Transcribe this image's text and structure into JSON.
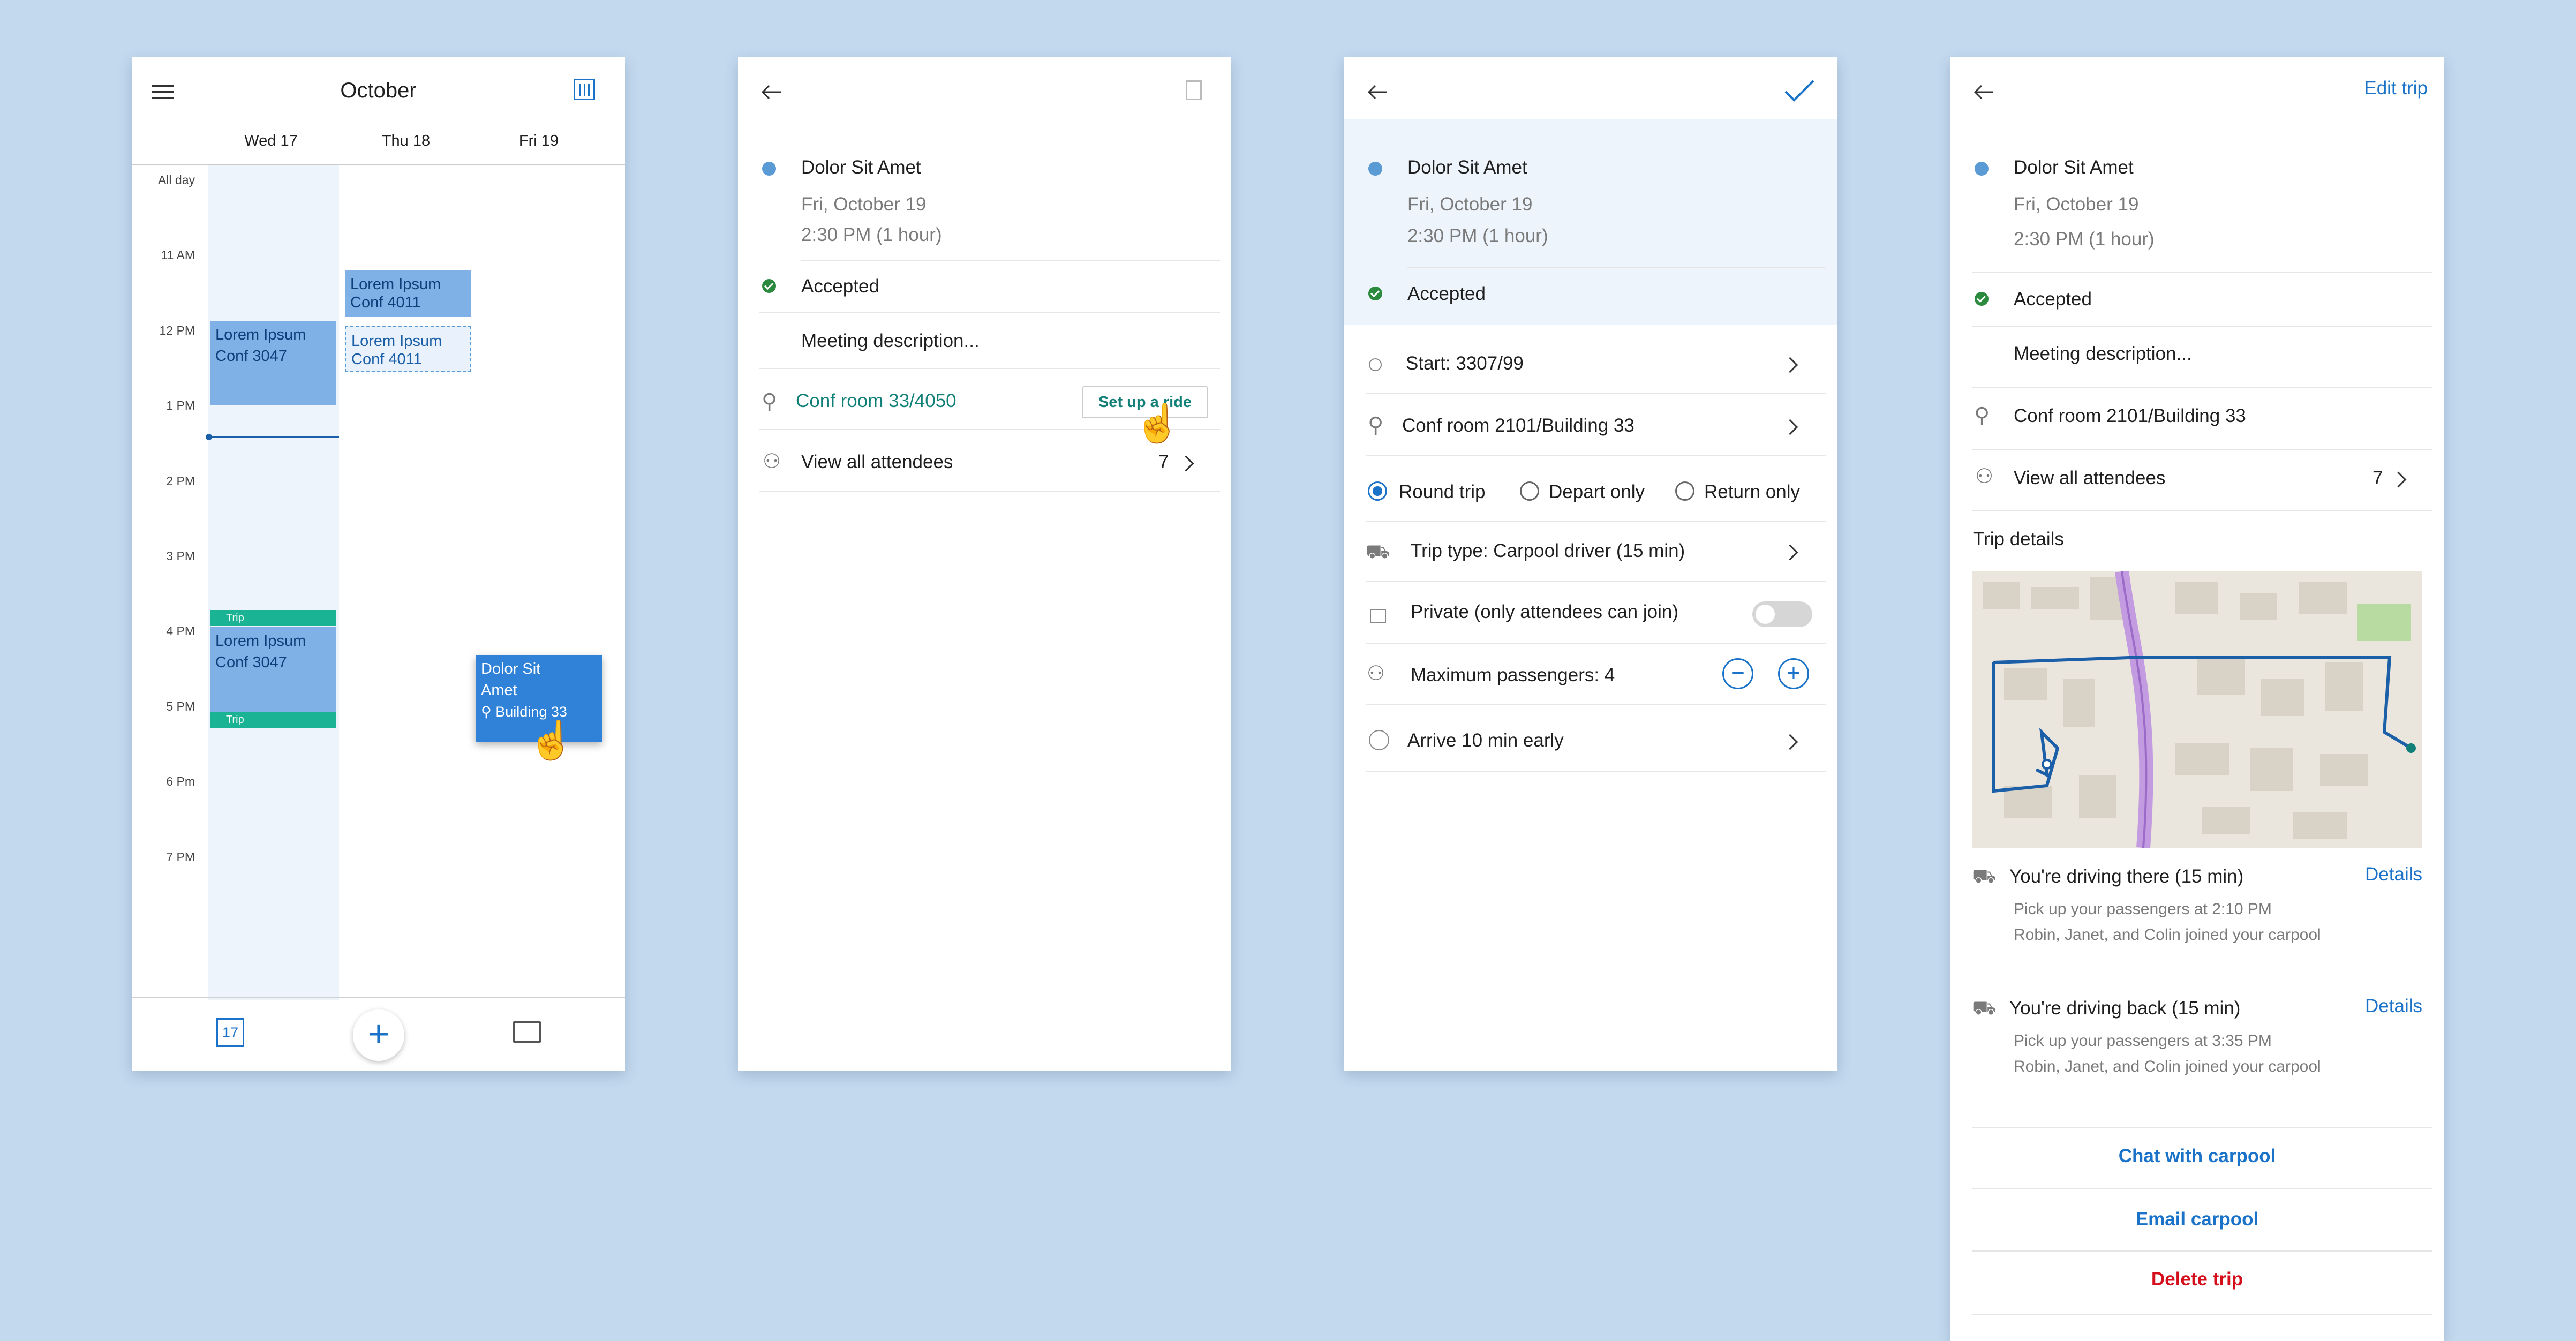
{
  "calendar": {
    "month": "October",
    "days": [
      "Wed 17",
      "Thu 18",
      "Fri 19"
    ],
    "allday": "All day",
    "times": [
      "11 AM",
      "12 PM",
      "1 PM",
      "2 PM",
      "3 PM",
      "4 PM",
      "5 PM",
      "6 Pm",
      "7 PM"
    ],
    "ev1": {
      "title": "Lorem Ipsum",
      "sub": "Conf 3047"
    },
    "ev2": {
      "title": "Lorem Ipsum",
      "sub": "Conf 4011"
    },
    "ev3": {
      "title": "Lorem Ipsum",
      "sub": "Conf 4011"
    },
    "ev4": {
      "title": "Lorem Ipsum",
      "sub": "Conf 3047"
    },
    "trip_label": "Trip",
    "drag": {
      "title": "Dolor Sit Amet",
      "sub": "Building 33"
    },
    "date_badge": "17"
  },
  "event": {
    "title": "Dolor Sit Amet",
    "date": "Fri, October 19",
    "time": "2:30 PM (1 hour)",
    "accepted": "Accepted",
    "description": "Meeting description...",
    "location": "Conf room 33/4050",
    "setup_ride": "Set up a ride",
    "attendees": "View all attendees",
    "attendees_count": "7"
  },
  "setup": {
    "title": "Dolor Sit Amet",
    "date": "Fri, October 19",
    "time": "2:30 PM (1 hour)",
    "accepted": "Accepted",
    "start": "Start: 3307/99",
    "destination": "Conf room 2101/Building 33",
    "radio": [
      "Round trip",
      "Depart only",
      "Return only"
    ],
    "trip_type": "Trip type: Carpool driver (15 min)",
    "private": "Private (only attendees can join)",
    "max_passengers": "Maximum passengers: 4",
    "arrive": "Arrive 10 min early"
  },
  "trip": {
    "edit": "Edit trip",
    "title": "Dolor Sit Amet",
    "date": "Fri, October 19",
    "time": "2:30 PM (1 hour)",
    "accepted": "Accepted",
    "description": "Meeting description...",
    "location": "Conf room 2101/Building 33",
    "attendees": "View all attendees",
    "attendees_count": "7",
    "details_header": "Trip details",
    "there": {
      "label": "You're driving there (15 min)",
      "link": "Details",
      "line1": "Pick up your passengers at 2:10 PM",
      "line2": "Robin, Janet, and Colin joined your carpool"
    },
    "back": {
      "label": "You're driving back (15 min)",
      "link": "Details",
      "line1": "Pick up your passengers at 3:35 PM",
      "line2": "Robin, Janet, and Colin joined your carpool"
    },
    "chat": "Chat with carpool",
    "email": "Email carpool",
    "delete": "Delete trip"
  }
}
